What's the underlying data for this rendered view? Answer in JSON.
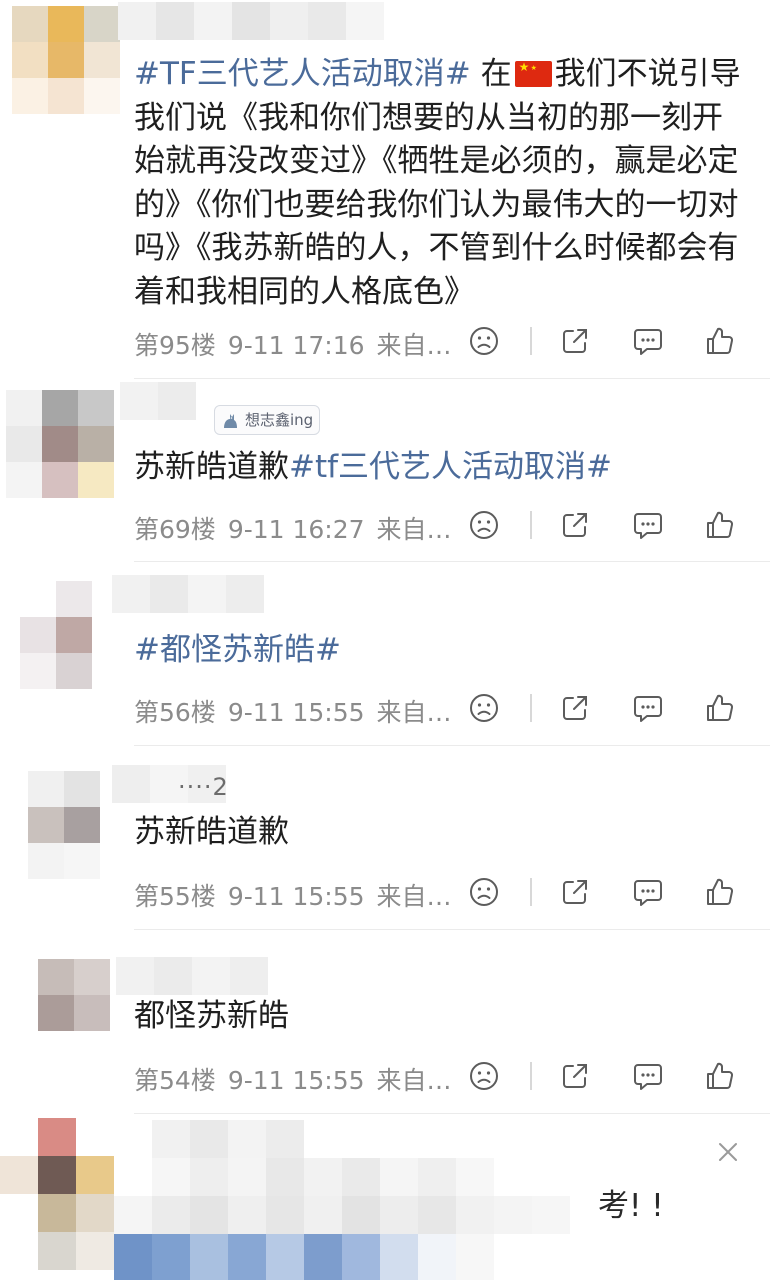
{
  "comments": [
    {
      "id": "c95",
      "segments": [
        {
          "text": "#TF三代艺人活动取消#",
          "kind": "topic"
        },
        {
          "text": " 在",
          "kind": "plain"
        },
        {
          "text": "",
          "kind": "flag"
        },
        {
          "text": "我们不说引导我们说《我和你们想要的从当初的那一刻开始就再没改变过》《牺牲是必须的，赢是必定的》《你们也要给我你们认为最伟大的一切对吗》《我苏新皓的人，不管到什么时候都会有着和我相同的人格底色》",
          "kind": "plain"
        }
      ],
      "floor": "第95楼",
      "time": "9-11 17:16",
      "source": "来自…"
    },
    {
      "id": "c69",
      "badge": "想志鑫ing",
      "segments": [
        {
          "text": "苏新皓道歉",
          "kind": "plain"
        },
        {
          "text": "#tf三代艺人活动取消#",
          "kind": "topic"
        }
      ],
      "floor": "第69楼",
      "time": "9-11 16:27",
      "source": "来自…"
    },
    {
      "id": "c56",
      "segments": [
        {
          "text": "#都怪苏新皓#",
          "kind": "topic"
        }
      ],
      "floor": "第56楼",
      "time": "9-11 15:55",
      "source": "来自…"
    },
    {
      "id": "c55",
      "name_fragment": "····2",
      "segments": [
        {
          "text": "苏新皓道歉",
          "kind": "plain"
        }
      ],
      "floor": "第55楼",
      "time": "9-11 15:55",
      "source": "来自…"
    },
    {
      "id": "c54",
      "segments": [
        {
          "text": "都怪苏新皓",
          "kind": "plain"
        }
      ],
      "floor": "第54楼",
      "time": "9-11 15:55",
      "source": "来自…"
    }
  ],
  "ad": {
    "text_fragment": "考! !"
  },
  "icons": {
    "dislike": "sad-face-icon",
    "share": "share-icon",
    "comment": "comment-icon",
    "like": "thumbs-up-icon",
    "close": "close-icon"
  },
  "colors": {
    "topic": "#4b6b9a",
    "meta": "#8b8b8b",
    "icon": "#5c5c5c"
  }
}
